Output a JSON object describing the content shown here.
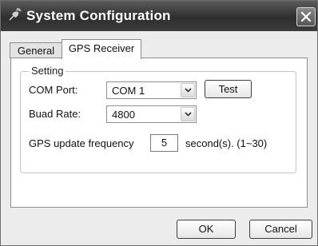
{
  "window": {
    "title": "System Configuration",
    "app_icon": "satellite-icon",
    "close_icon": "close-icon"
  },
  "tabs": [
    {
      "label": "General",
      "active": false
    },
    {
      "label": "GPS Receiver",
      "active": true
    }
  ],
  "setting": {
    "group_label": "Setting",
    "com_port": {
      "label": "COM Port:",
      "value": "COM 1"
    },
    "test_button": "Test",
    "baud_rate": {
      "label": "Buad Rate:",
      "value": "4800"
    },
    "update_frequency": {
      "label": "GPS update frequency",
      "value": "5",
      "suffix": "second(s). (1~30)"
    }
  },
  "buttons": {
    "ok": "OK",
    "cancel": "Cancel"
  }
}
